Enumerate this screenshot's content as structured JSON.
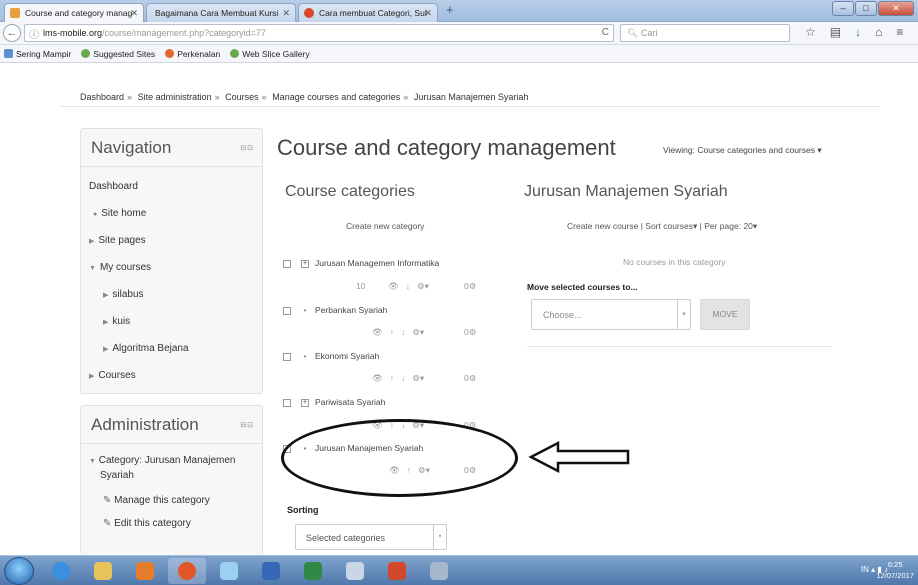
{
  "browser": {
    "tabs": [
      {
        "label": "Course and category manag"
      },
      {
        "label": "Bagaimana Cara Membuat Kursi"
      },
      {
        "label": "Cara membuat Categori, Sul"
      }
    ],
    "url_domain": "lms-mobile.org",
    "url_path": "/course/management.php?categoryid=77",
    "search_placeholder": "Cari",
    "bookmarks": [
      "Sering Mampir",
      "Suggested Sites",
      "Perkenalan",
      "Web Slice Gallery"
    ]
  },
  "breadcrumb": [
    "Dashboard",
    "Site administration",
    "Courses",
    "Manage courses and categories",
    "Jurusan Manajemen Syariah"
  ],
  "navigation": {
    "title": "Navigation",
    "items": [
      {
        "label": "Dashboard"
      },
      {
        "label": "Site home"
      },
      {
        "label": "Site pages"
      },
      {
        "label": "My courses"
      },
      {
        "label": "silabus"
      },
      {
        "label": "kuis"
      },
      {
        "label": "Algoritma Bejana"
      },
      {
        "label": "Courses"
      }
    ]
  },
  "administration": {
    "title": "Administration",
    "category_line1": "Category: Jurusan Manajemen",
    "category_line2": "Syariah",
    "items": [
      {
        "label": "Manage this category"
      },
      {
        "label": "Edit this category"
      }
    ]
  },
  "main": {
    "title": "Course and category management",
    "viewing": "Viewing: Course categories and courses"
  },
  "categories": {
    "title": "Course categories",
    "create_link": "Create new category",
    "rows": [
      {
        "name": "Jurusan Managemen Informatika",
        "count": "10"
      },
      {
        "name": "Perbankan Syariah"
      },
      {
        "name": "Ekonomi Syariah"
      },
      {
        "name": "Pariwisata Syariah"
      },
      {
        "name": "Jurusan Manajemen Syariah"
      }
    ],
    "sorting_label": "Sorting",
    "sorting_value": "Selected categories"
  },
  "course_panel": {
    "title": "Jurusan Manajemen Syariah",
    "create_course": "Create new course",
    "sort_courses": "Sort courses",
    "per_page": "Per page: 20",
    "empty_text": "No courses in this category",
    "move_label": "Move selected courses to...",
    "move_placeholder": "Choose...",
    "move_button": "MOVE"
  },
  "taskbar": {
    "lang": "IN",
    "time": "6:25",
    "date": "12/07/2017"
  }
}
